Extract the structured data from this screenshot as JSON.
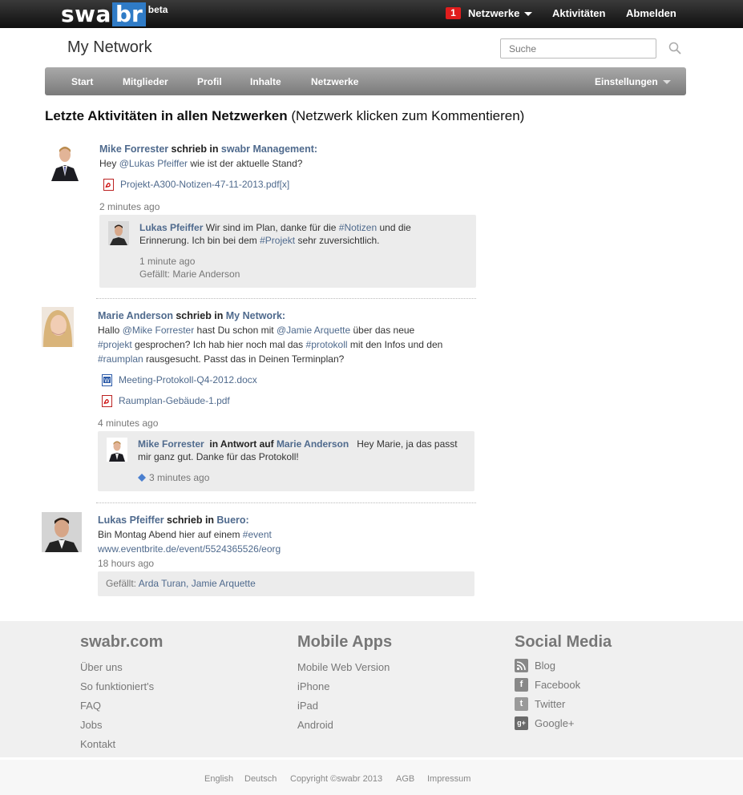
{
  "topbar": {
    "logo": {
      "part1": "swa",
      "part2": "br",
      "badge": "beta"
    },
    "notifications_count": "1",
    "networks_label": "Netzwerke",
    "activities_label": "Aktivitäten",
    "logout_label": "Abmelden"
  },
  "header": {
    "title": "My Network",
    "search_placeholder": "Suche"
  },
  "nav": {
    "items": [
      "Start",
      "Mitglieder",
      "Profil",
      "Inhalte",
      "Netzwerke"
    ],
    "settings_label": "Einstellungen"
  },
  "heading": {
    "bold": "Letzte Aktivitäten in allen Netzwerken",
    "hint": "(Netzwerk klicken zum Kommentieren)"
  },
  "posts": [
    {
      "author": "Mike Forrester",
      "verb": "schrieb in",
      "network": "swabr Management:",
      "line1_pre": "Hey ",
      "line1_mention": "@Lukas Pfeiffer",
      "line1_post": " wie ist der aktuelle Stand?",
      "file": "Projekt-A300-Notizen-47-11-2013.pdf",
      "file_suffix": "[x]",
      "time": "2 minutes ago",
      "comment": {
        "author": "Lukas Pfeiffer",
        "text1": " Wir sind im Plan, danke für die ",
        "tag1": "#Notizen",
        "text2": " und die",
        "line2_pre": "Erinnerung. Ich bin bei dem ",
        "tag2": "#Projekt",
        "line2_post": " sehr zuversichtlich.",
        "time": "1 minute ago",
        "likes": "Gefällt: Marie Anderson"
      }
    },
    {
      "author": "Marie Anderson",
      "verb": "schrieb in",
      "network": "My Network:",
      "l1_pre": "Hallo ",
      "l1_m1": "@Mike Forrester",
      "l1_mid": " hast Du schon mit ",
      "l1_m2": "@Jamie Arquette",
      "l1_post": " über das neue",
      "l2_tag1": "#projekt",
      "l2_mid": " gesprochen? Ich hab hier noch mal das ",
      "l2_tag2": "#protokoll",
      "l2_post": " mit den Infos und den",
      "l3_tag": "#raumplan",
      "l3_post": " rausgesucht. Passt das in Deinen Terminplan?",
      "file1": "Meeting-Protokoll-Q4-2012.docx",
      "file2": "Raumplan-Gebäude-1.pdf",
      "time": "4 minutes ago",
      "comment": {
        "author": "Mike Forrester",
        "reply_label": "in Antwort auf",
        "reply_to": "Marie Anderson",
        "text1": "Hey Marie, ja das passt",
        "text2": "mir ganz gut. Danke für das Protokoll!",
        "time": "3 minutes ago"
      }
    },
    {
      "author": "Lukas Pfeiffer",
      "verb": "schrieb in",
      "network": "Buero:",
      "l1_pre": "Bin Montag Abend hier auf einem ",
      "l1_tag": "#event",
      "url": "www.eventbrite.de/event/5524365526/eorg",
      "time": "18 hours ago",
      "likes_label": "Gefällt: ",
      "likes_names": "Arda Turan, Jamie Arquette"
    }
  ],
  "footer": {
    "col1": {
      "title": "swabr.com",
      "links": [
        "Über uns",
        "So funktioniert's",
        "FAQ",
        "Jobs",
        "Kontakt"
      ]
    },
    "col2": {
      "title": "Mobile Apps",
      "links": [
        "Mobile Web Version",
        "iPhone",
        "iPad",
        "Android"
      ]
    },
    "col3": {
      "title": "Social Media",
      "links": [
        "Blog",
        "Facebook",
        "Twitter",
        "Google+"
      ],
      "icons": [
        "rss-icon",
        "facebook-icon",
        "twitter-icon",
        "google-plus-icon"
      ]
    },
    "bottom": [
      "English",
      "Deutsch",
      "Copyright ©swabr 2013",
      "AGB",
      "Impressum"
    ]
  },
  "colors": {
    "link": "#4f6a8d",
    "brand_blue": "#2f7bc6",
    "badge_red": "#e11d1d"
  }
}
